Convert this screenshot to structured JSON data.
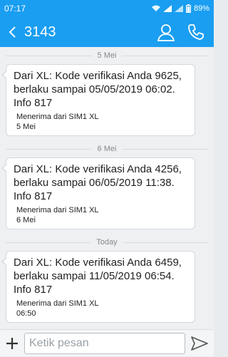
{
  "status_bar": {
    "time": "07:17",
    "battery": "89%"
  },
  "header": {
    "title": "3143"
  },
  "messages": [
    {
      "date": "5 Mei",
      "body": "Dari XL: Kode verifikasi Anda 9625, berlaku sampai 05/05/2019 06:02. Info 817",
      "sim": "Menerima dari SIM1 XL",
      "time": "5 Mei"
    },
    {
      "date": "6 Mei",
      "body": "Dari XL: Kode verifikasi Anda 4256, berlaku sampai 06/05/2019 11:38. Info 817",
      "sim": "Menerima dari SIM1 XL",
      "time": "6 Mei"
    },
    {
      "date": "Today",
      "body": "Dari XL: Kode verifikasi Anda 6459, berlaku sampai 11/05/2019 06:54. Info 817",
      "sim": "Menerima dari SIM1 XL",
      "time": "06:50"
    }
  ],
  "composer": {
    "placeholder": "Ketik pesan"
  },
  "colors": {
    "accent": "#1a9ef1",
    "background": "#eef0f2"
  }
}
